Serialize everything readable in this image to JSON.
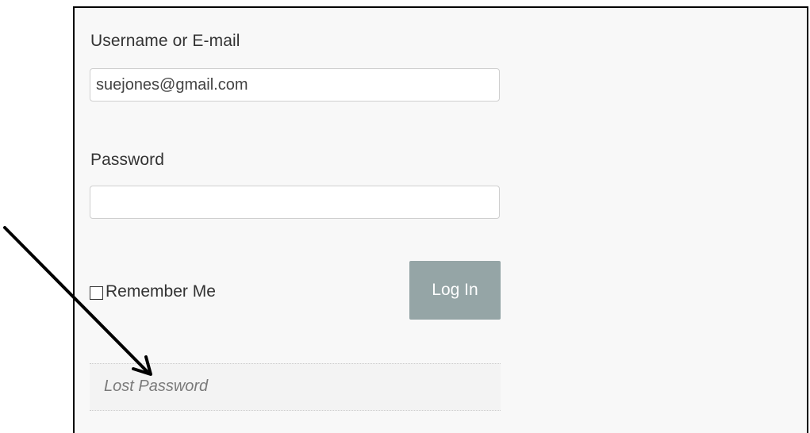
{
  "login_form": {
    "username_label": "Username or E-mail",
    "username_value": "suejones@gmail.com",
    "password_label": "Password",
    "password_value": "",
    "remember_label": "Remember Me",
    "remember_checked": false,
    "login_button_label": "Log In",
    "lost_password_link": "Lost Password"
  },
  "annotation": {
    "icon": "arrow-icon",
    "color": "#000000",
    "points_to": "lost-password-link"
  },
  "colors": {
    "button_bg": "#95a5a6",
    "panel_bg": "#f8f8f8"
  }
}
